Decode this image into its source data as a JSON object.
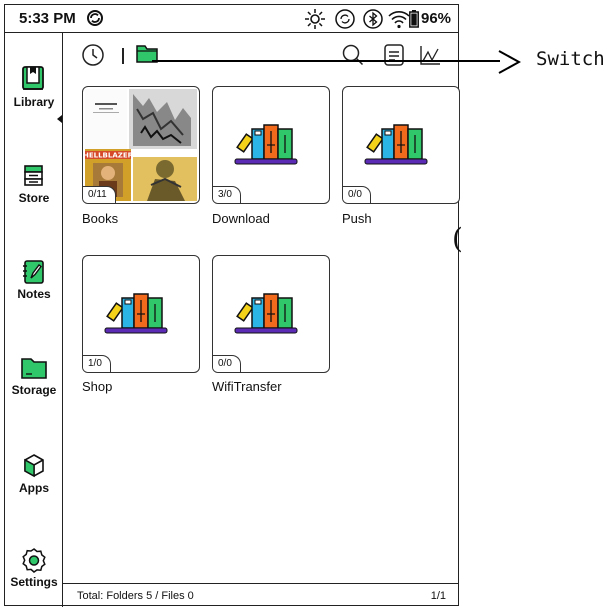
{
  "status_bar": {
    "time": "5:33 PM",
    "battery_percent": "96%",
    "icons": [
      "sync-icon",
      "brightness-icon",
      "refresh-icon",
      "bluetooth-icon",
      "wifi-icon",
      "battery-icon"
    ]
  },
  "sidebar": {
    "items": [
      {
        "label": "Library",
        "icon": "library-icon",
        "active": true
      },
      {
        "label": "Store",
        "icon": "store-icon"
      },
      {
        "label": "Notes",
        "icon": "notes-icon"
      },
      {
        "label": "Storage",
        "icon": "storage-icon"
      },
      {
        "label": "Apps",
        "icon": "apps-icon"
      },
      {
        "label": "Settings",
        "icon": "settings-icon"
      }
    ]
  },
  "toolbar": {
    "icons": [
      "recent-clock-icon",
      "folder-view-icon",
      "search-icon",
      "list-icon",
      "stats-icon"
    ]
  },
  "folders": [
    {
      "name": "Books",
      "count": "0/11",
      "thumb": "covers"
    },
    {
      "name": "Download",
      "count": "3/0",
      "thumb": "bookshelf"
    },
    {
      "name": "Push",
      "count": "0/0",
      "thumb": "bookshelf"
    },
    {
      "name": "Shop",
      "count": "1/0",
      "thumb": "bookshelf"
    },
    {
      "name": "WifiTransfer",
      "count": "0/0",
      "thumb": "bookshelf"
    }
  ],
  "footer": {
    "total": "Total: Folders 5 / Files 0",
    "page": "1/1"
  },
  "annotation": {
    "label": "Switch"
  },
  "colors": {
    "accent_green": "#2fc76a",
    "book_orange": "#f26b1d",
    "book_blue": "#2bb5e6",
    "book_yellow": "#f5d21a",
    "shelf_purple": "#5b2bb5"
  }
}
